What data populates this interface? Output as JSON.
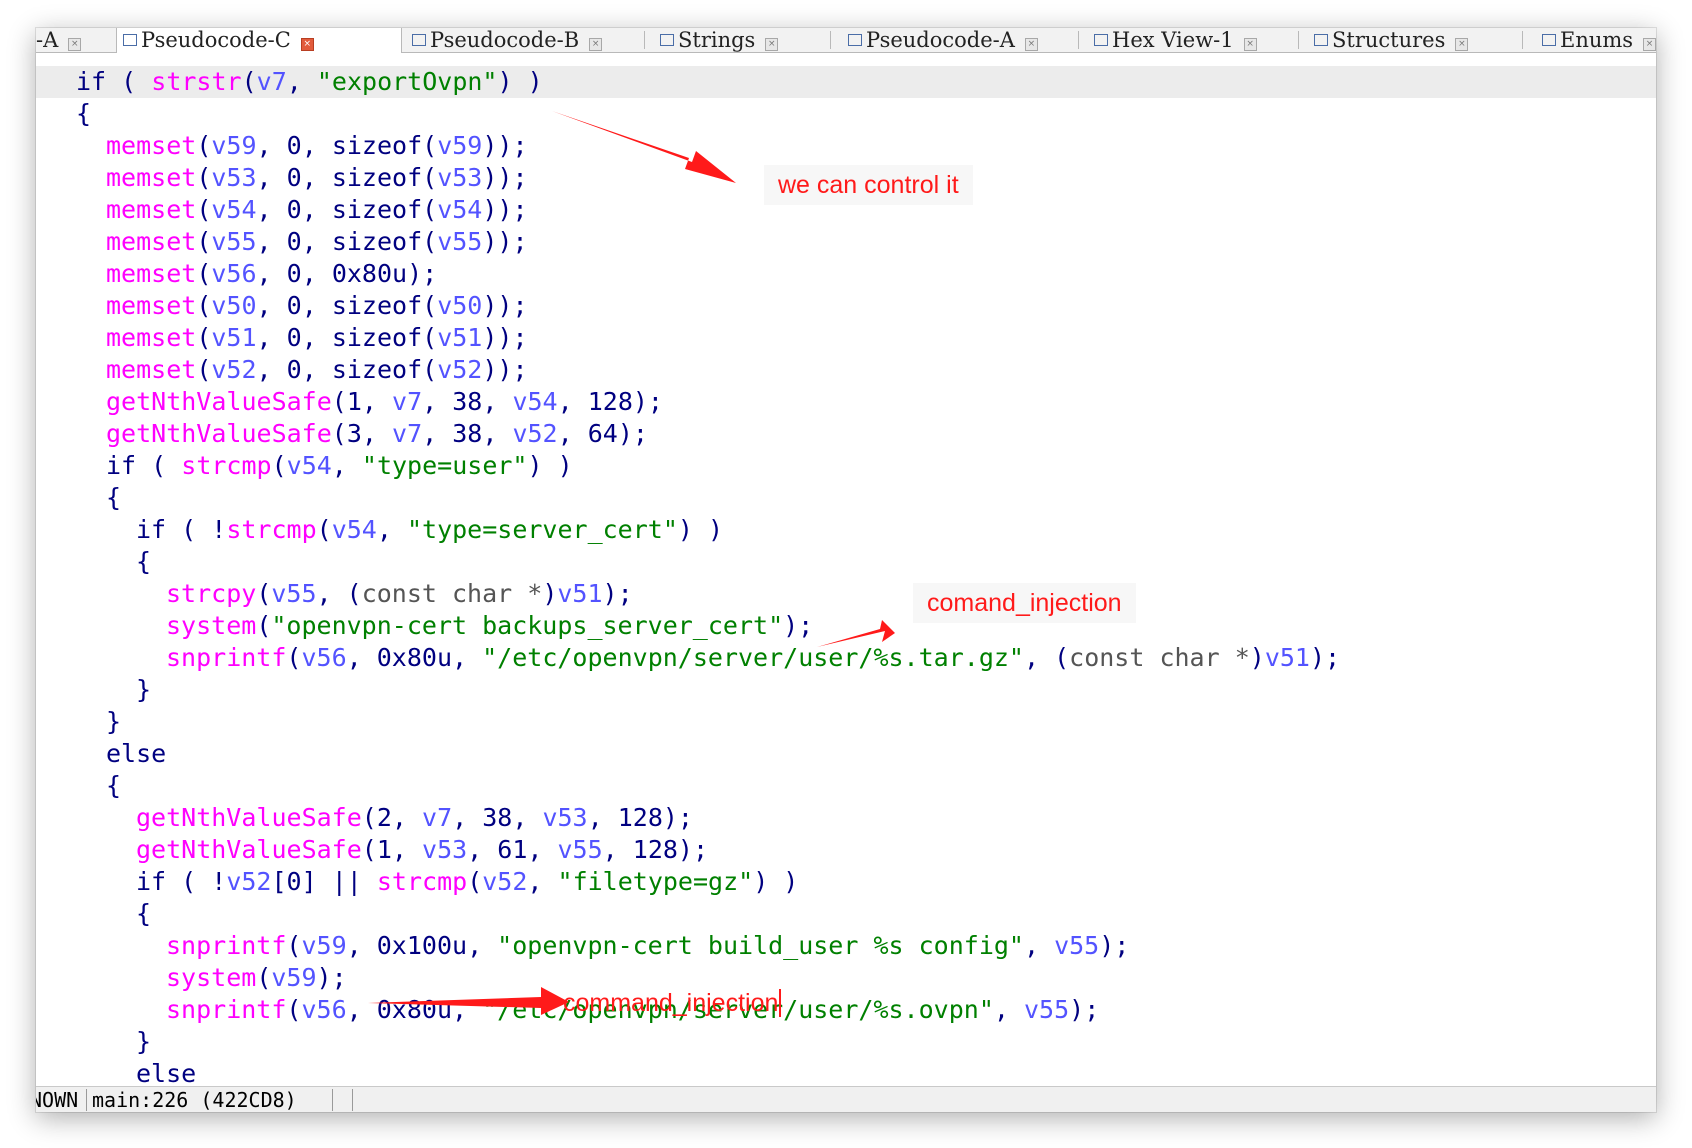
{
  "tabs": [
    {
      "label": "-A",
      "active": false
    },
    {
      "label": "Pseudocode-C",
      "active": true
    },
    {
      "label": "Pseudocode-B",
      "active": false
    },
    {
      "label": "Strings",
      "active": false
    },
    {
      "label": "Pseudocode-A",
      "active": false
    },
    {
      "label": "Hex View-1",
      "active": false
    },
    {
      "label": "Structures",
      "active": false
    },
    {
      "label": "Enums",
      "active": false
    }
  ],
  "code": {
    "lines": [
      {
        "indent": 1,
        "highlight": true,
        "tokens": [
          [
            "kw",
            "if"
          ],
          [
            "pun",
            " ( "
          ],
          [
            "fn",
            "strstr"
          ],
          [
            "pun",
            "("
          ],
          [
            "var",
            "v7"
          ],
          [
            "pun",
            ", "
          ],
          [
            "str",
            "\"exportOvpn\""
          ],
          [
            "pun",
            ") )"
          ]
        ]
      },
      {
        "indent": 1,
        "tokens": [
          [
            "pun",
            "{"
          ]
        ]
      },
      {
        "indent": 2,
        "tokens": [
          [
            "fn",
            "memset"
          ],
          [
            "pun",
            "("
          ],
          [
            "var",
            "v59"
          ],
          [
            "pun",
            ", "
          ],
          [
            "num",
            "0"
          ],
          [
            "pun",
            ", "
          ],
          [
            "kw",
            "sizeof"
          ],
          [
            "pun",
            "("
          ],
          [
            "var",
            "v59"
          ],
          [
            "pun",
            "));"
          ]
        ]
      },
      {
        "indent": 2,
        "tokens": [
          [
            "fn",
            "memset"
          ],
          [
            "pun",
            "("
          ],
          [
            "var",
            "v53"
          ],
          [
            "pun",
            ", "
          ],
          [
            "num",
            "0"
          ],
          [
            "pun",
            ", "
          ],
          [
            "kw",
            "sizeof"
          ],
          [
            "pun",
            "("
          ],
          [
            "var",
            "v53"
          ],
          [
            "pun",
            "));"
          ]
        ]
      },
      {
        "indent": 2,
        "tokens": [
          [
            "fn",
            "memset"
          ],
          [
            "pun",
            "("
          ],
          [
            "var",
            "v54"
          ],
          [
            "pun",
            ", "
          ],
          [
            "num",
            "0"
          ],
          [
            "pun",
            ", "
          ],
          [
            "kw",
            "sizeof"
          ],
          [
            "pun",
            "("
          ],
          [
            "var",
            "v54"
          ],
          [
            "pun",
            "));"
          ]
        ]
      },
      {
        "indent": 2,
        "tokens": [
          [
            "fn",
            "memset"
          ],
          [
            "pun",
            "("
          ],
          [
            "var",
            "v55"
          ],
          [
            "pun",
            ", "
          ],
          [
            "num",
            "0"
          ],
          [
            "pun",
            ", "
          ],
          [
            "kw",
            "sizeof"
          ],
          [
            "pun",
            "("
          ],
          [
            "var",
            "v55"
          ],
          [
            "pun",
            "));"
          ]
        ]
      },
      {
        "indent": 2,
        "tokens": [
          [
            "fn",
            "memset"
          ],
          [
            "pun",
            "("
          ],
          [
            "var",
            "v56"
          ],
          [
            "pun",
            ", "
          ],
          [
            "num",
            "0"
          ],
          [
            "pun",
            ", "
          ],
          [
            "num",
            "0x80u"
          ],
          [
            "pun",
            ");"
          ]
        ]
      },
      {
        "indent": 2,
        "tokens": [
          [
            "fn",
            "memset"
          ],
          [
            "pun",
            "("
          ],
          [
            "var",
            "v50"
          ],
          [
            "pun",
            ", "
          ],
          [
            "num",
            "0"
          ],
          [
            "pun",
            ", "
          ],
          [
            "kw",
            "sizeof"
          ],
          [
            "pun",
            "("
          ],
          [
            "var",
            "v50"
          ],
          [
            "pun",
            "));"
          ]
        ]
      },
      {
        "indent": 2,
        "tokens": [
          [
            "fn",
            "memset"
          ],
          [
            "pun",
            "("
          ],
          [
            "var",
            "v51"
          ],
          [
            "pun",
            ", "
          ],
          [
            "num",
            "0"
          ],
          [
            "pun",
            ", "
          ],
          [
            "kw",
            "sizeof"
          ],
          [
            "pun",
            "("
          ],
          [
            "var",
            "v51"
          ],
          [
            "pun",
            "));"
          ]
        ]
      },
      {
        "indent": 2,
        "tokens": [
          [
            "fn",
            "memset"
          ],
          [
            "pun",
            "("
          ],
          [
            "var",
            "v52"
          ],
          [
            "pun",
            ", "
          ],
          [
            "num",
            "0"
          ],
          [
            "pun",
            ", "
          ],
          [
            "kw",
            "sizeof"
          ],
          [
            "pun",
            "("
          ],
          [
            "var",
            "v52"
          ],
          [
            "pun",
            "));"
          ]
        ]
      },
      {
        "indent": 2,
        "tokens": [
          [
            "fn",
            "getNthValueSafe"
          ],
          [
            "pun",
            "("
          ],
          [
            "num",
            "1"
          ],
          [
            "pun",
            ", "
          ],
          [
            "var",
            "v7"
          ],
          [
            "pun",
            ", "
          ],
          [
            "num",
            "38"
          ],
          [
            "pun",
            ", "
          ],
          [
            "var",
            "v54"
          ],
          [
            "pun",
            ", "
          ],
          [
            "num",
            "128"
          ],
          [
            "pun",
            ");"
          ]
        ]
      },
      {
        "indent": 2,
        "tokens": [
          [
            "fn",
            "getNthValueSafe"
          ],
          [
            "pun",
            "("
          ],
          [
            "num",
            "3"
          ],
          [
            "pun",
            ", "
          ],
          [
            "var",
            "v7"
          ],
          [
            "pun",
            ", "
          ],
          [
            "num",
            "38"
          ],
          [
            "pun",
            ", "
          ],
          [
            "var",
            "v52"
          ],
          [
            "pun",
            ", "
          ],
          [
            "num",
            "64"
          ],
          [
            "pun",
            ");"
          ]
        ]
      },
      {
        "indent": 2,
        "tokens": [
          [
            "kw",
            "if"
          ],
          [
            "pun",
            " ( "
          ],
          [
            "fn",
            "strcmp"
          ],
          [
            "pun",
            "("
          ],
          [
            "var",
            "v54"
          ],
          [
            "pun",
            ", "
          ],
          [
            "str",
            "\"type=user\""
          ],
          [
            "pun",
            ") )"
          ]
        ]
      },
      {
        "indent": 2,
        "tokens": [
          [
            "pun",
            "{"
          ]
        ]
      },
      {
        "indent": 3,
        "tokens": [
          [
            "kw",
            "if"
          ],
          [
            "pun",
            " ( !"
          ],
          [
            "fn",
            "strcmp"
          ],
          [
            "pun",
            "("
          ],
          [
            "var",
            "v54"
          ],
          [
            "pun",
            ", "
          ],
          [
            "str",
            "\"type=server_cert\""
          ],
          [
            "pun",
            ") )"
          ]
        ]
      },
      {
        "indent": 3,
        "tokens": [
          [
            "pun",
            "{"
          ]
        ]
      },
      {
        "indent": 4,
        "tokens": [
          [
            "fn",
            "strcpy"
          ],
          [
            "pun",
            "("
          ],
          [
            "var",
            "v55"
          ],
          [
            "pun",
            ", ("
          ],
          [
            "typ",
            "const char *"
          ],
          [
            "pun",
            ")"
          ],
          [
            "var",
            "v51"
          ],
          [
            "pun",
            ");"
          ]
        ]
      },
      {
        "indent": 4,
        "tokens": [
          [
            "fn",
            "system"
          ],
          [
            "pun",
            "("
          ],
          [
            "str",
            "\"openvpn-cert backups_server_cert\""
          ],
          [
            "pun",
            ");"
          ]
        ]
      },
      {
        "indent": 4,
        "tokens": [
          [
            "fn",
            "snprintf"
          ],
          [
            "pun",
            "("
          ],
          [
            "var",
            "v56"
          ],
          [
            "pun",
            ", "
          ],
          [
            "num",
            "0x80u"
          ],
          [
            "pun",
            ", "
          ],
          [
            "str",
            "\"/etc/openvpn/server/user/%s.tar.gz\""
          ],
          [
            "pun",
            ", ("
          ],
          [
            "typ",
            "const char *"
          ],
          [
            "pun",
            ")"
          ],
          [
            "var",
            "v51"
          ],
          [
            "pun",
            ");"
          ]
        ]
      },
      {
        "indent": 3,
        "tokens": [
          [
            "pun",
            "}"
          ]
        ]
      },
      {
        "indent": 2,
        "tokens": [
          [
            "pun",
            "}"
          ]
        ]
      },
      {
        "indent": 2,
        "tokens": [
          [
            "kw",
            "else"
          ]
        ]
      },
      {
        "indent": 2,
        "tokens": [
          [
            "pun",
            "{"
          ]
        ]
      },
      {
        "indent": 3,
        "tokens": [
          [
            "fn",
            "getNthValueSafe"
          ],
          [
            "pun",
            "("
          ],
          [
            "num",
            "2"
          ],
          [
            "pun",
            ", "
          ],
          [
            "var",
            "v7"
          ],
          [
            "pun",
            ", "
          ],
          [
            "num",
            "38"
          ],
          [
            "pun",
            ", "
          ],
          [
            "var",
            "v53"
          ],
          [
            "pun",
            ", "
          ],
          [
            "num",
            "128"
          ],
          [
            "pun",
            ");"
          ]
        ]
      },
      {
        "indent": 3,
        "tokens": [
          [
            "fn",
            "getNthValueSafe"
          ],
          [
            "pun",
            "("
          ],
          [
            "num",
            "1"
          ],
          [
            "pun",
            ", "
          ],
          [
            "var",
            "v53"
          ],
          [
            "pun",
            ", "
          ],
          [
            "num",
            "61"
          ],
          [
            "pun",
            ", "
          ],
          [
            "var",
            "v55"
          ],
          [
            "pun",
            ", "
          ],
          [
            "num",
            "128"
          ],
          [
            "pun",
            ");"
          ]
        ]
      },
      {
        "indent": 3,
        "tokens": [
          [
            "kw",
            "if"
          ],
          [
            "pun",
            " ( !"
          ],
          [
            "var",
            "v52"
          ],
          [
            "pun",
            "["
          ],
          [
            "num",
            "0"
          ],
          [
            "pun",
            "] || "
          ],
          [
            "fn",
            "strcmp"
          ],
          [
            "pun",
            "("
          ],
          [
            "var",
            "v52"
          ],
          [
            "pun",
            ", "
          ],
          [
            "str",
            "\"filetype=gz\""
          ],
          [
            "pun",
            ") )"
          ]
        ]
      },
      {
        "indent": 3,
        "tokens": [
          [
            "pun",
            "{"
          ]
        ]
      },
      {
        "indent": 4,
        "tokens": [
          [
            "fn",
            "snprintf"
          ],
          [
            "pun",
            "("
          ],
          [
            "var",
            "v59"
          ],
          [
            "pun",
            ", "
          ],
          [
            "num",
            "0x100u"
          ],
          [
            "pun",
            ", "
          ],
          [
            "str",
            "\"openvpn-cert build_user %s config\""
          ],
          [
            "pun",
            ", "
          ],
          [
            "var",
            "v55"
          ],
          [
            "pun",
            ");"
          ]
        ]
      },
      {
        "indent": 4,
        "tokens": [
          [
            "fn",
            "system"
          ],
          [
            "pun",
            "("
          ],
          [
            "var",
            "v59"
          ],
          [
            "pun",
            ");"
          ]
        ]
      },
      {
        "indent": 4,
        "tokens": [
          [
            "fn",
            "snprintf"
          ],
          [
            "pun",
            "("
          ],
          [
            "var",
            "v56"
          ],
          [
            "pun",
            ", "
          ],
          [
            "num",
            "0x80u"
          ],
          [
            "pun",
            ", "
          ],
          [
            "str",
            "\"/etc/openvpn/server/user/%s.ovpn\""
          ],
          [
            "pun",
            ", "
          ],
          [
            "var",
            "v55"
          ],
          [
            "pun",
            ");"
          ]
        ]
      },
      {
        "indent": 3,
        "tokens": [
          [
            "pun",
            "}"
          ]
        ]
      },
      {
        "indent": 3,
        "tokens": [
          [
            "kw",
            "else"
          ]
        ]
      }
    ]
  },
  "annotations": {
    "control": "we can control it",
    "injection_1": "comand_injection",
    "injection_2": "command_injection",
    "color": "#ff1a1a"
  },
  "status": {
    "segment_a": "NOWN",
    "segment_b": "main:226 (422CD8)"
  }
}
